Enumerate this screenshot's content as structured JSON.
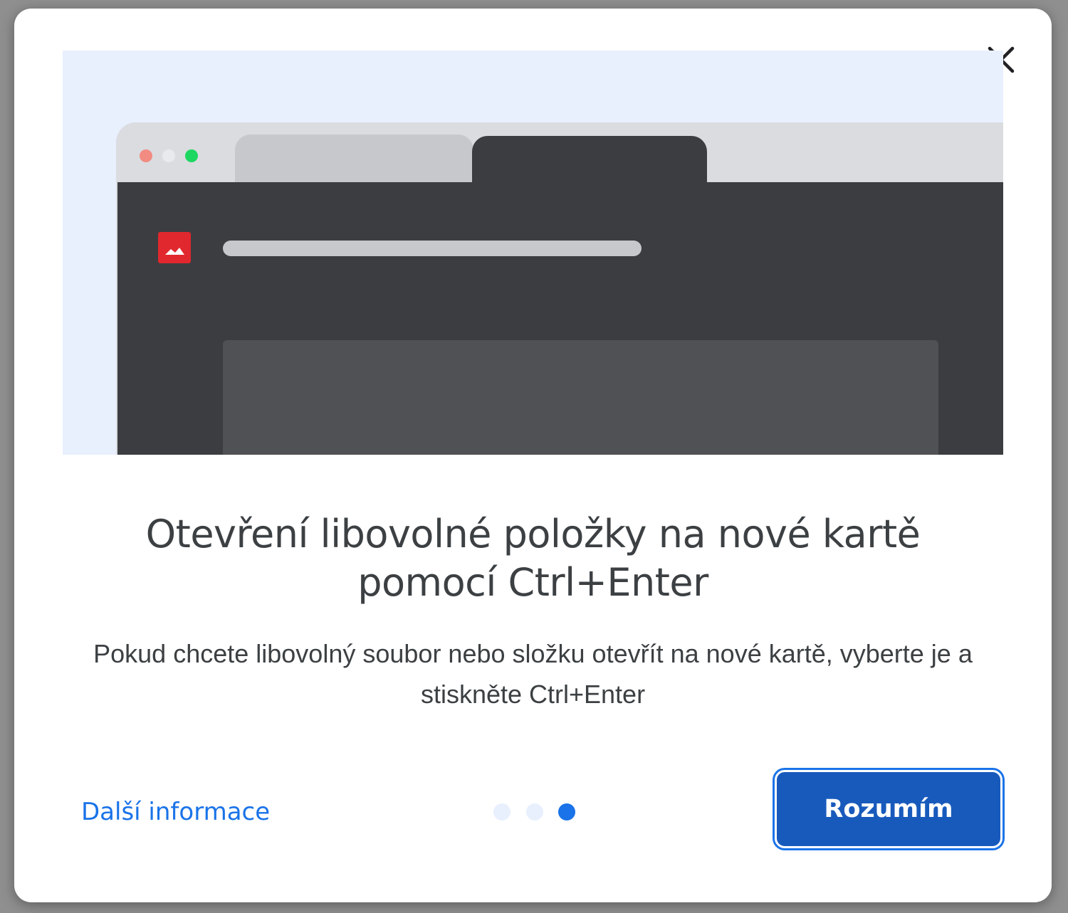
{
  "dialog": {
    "close_icon": "close-icon",
    "headline": "Otevření libovolné položky na nové kartě pomocí Ctrl+Enter",
    "description": "Pokud chcete libovolný soubor nebo složku otevřít na nové kartě, vyberte je a stiskněte Ctrl+Enter",
    "learn_more": "Další informace",
    "ok_label": "Rozumím",
    "pager": {
      "total": 3,
      "current": 3
    }
  },
  "illustration": {
    "icon": "image-file-icon",
    "traffic_colors": [
      "#f28b82",
      "#e8eaed",
      "#1ed760"
    ],
    "file_icon_color": "#e0282e"
  },
  "colors": {
    "accent": "#1a73e8",
    "button_bg": "#185abc",
    "dot_active": "#1a73e8",
    "dot_inactive": "#e8f0fe",
    "text": "#3c4043"
  }
}
